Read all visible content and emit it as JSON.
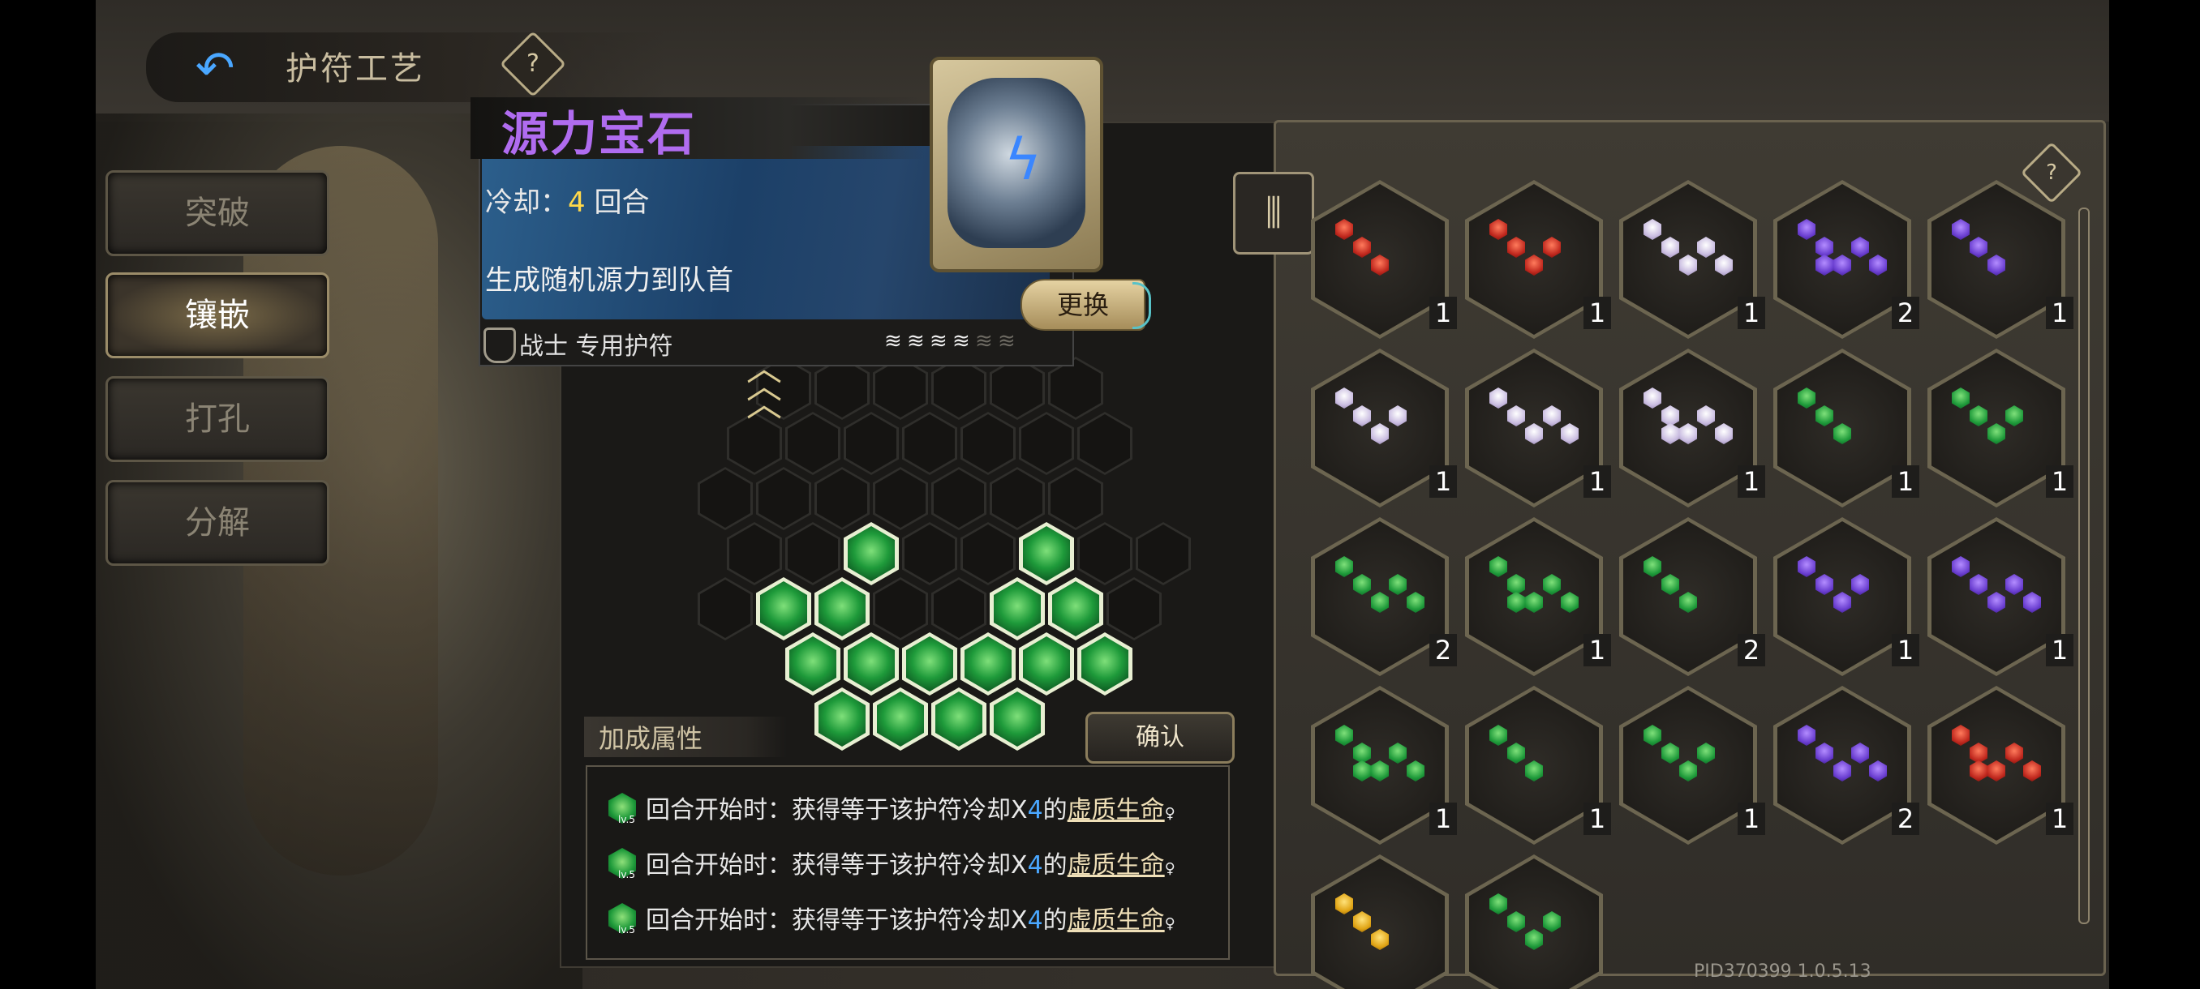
{
  "header": {
    "back_icon": "back-arrow-icon",
    "title": "护符工艺",
    "help_label": "?"
  },
  "menu": [
    {
      "label": "突破",
      "active": false
    },
    {
      "label": "镶嵌",
      "active": true
    },
    {
      "label": "打孔",
      "active": false
    },
    {
      "label": "分解",
      "active": false
    }
  ],
  "amulet_card": {
    "name": "源力宝石",
    "cooldown_label": "冷却：",
    "cooldown_value": "4",
    "cooldown_unit": " 回合",
    "effect": "生成随机源力到队首",
    "exchange_label": "更换",
    "class_label": "战士 专用护符",
    "stars_filled": 4,
    "stars_total": 6
  },
  "bonus": {
    "title": "加成属性",
    "confirm_label": "确认",
    "rows": [
      {
        "level": "lv.5",
        "prefix": "回合开始时：获得等于该护符冷却X",
        "num": "4",
        "mid": "的",
        "link": "虚质生命",
        "suffix": "♀"
      },
      {
        "level": "lv.5",
        "prefix": "回合开始时：获得等于该护符冷却X",
        "num": "4",
        "mid": "的",
        "link": "虚质生命",
        "suffix": "♀"
      },
      {
        "level": "lv.5",
        "prefix": "回合开始时：获得等于该护符冷却X",
        "num": "4",
        "mid": "的",
        "link": "虚质生命",
        "suffix": "♀"
      }
    ]
  },
  "inventory": {
    "filter_icon": "filter-icon",
    "help_label": "?",
    "items": [
      {
        "color": "red",
        "count": "1"
      },
      {
        "color": "red",
        "count": "1"
      },
      {
        "color": "white",
        "count": "1"
      },
      {
        "color": "purple",
        "count": "2"
      },
      {
        "color": "purple",
        "count": "1"
      },
      {
        "color": "white",
        "count": "1"
      },
      {
        "color": "white",
        "count": "1"
      },
      {
        "color": "white",
        "count": "1"
      },
      {
        "color": "green",
        "count": "1"
      },
      {
        "color": "green",
        "count": "1"
      },
      {
        "color": "green",
        "count": "2"
      },
      {
        "color": "green",
        "count": "1"
      },
      {
        "color": "green",
        "count": "2"
      },
      {
        "color": "purple",
        "count": "1"
      },
      {
        "color": "purple",
        "count": "1"
      },
      {
        "color": "green",
        "count": "1"
      },
      {
        "color": "green",
        "count": "1"
      },
      {
        "color": "green",
        "count": "1"
      },
      {
        "color": "purple",
        "count": "2"
      },
      {
        "color": "red",
        "count": "1"
      },
      {
        "color": "yellow",
        "count": ""
      },
      {
        "color": "green",
        "count": ""
      }
    ]
  },
  "build_id": "PID370399  1.0.5.13"
}
